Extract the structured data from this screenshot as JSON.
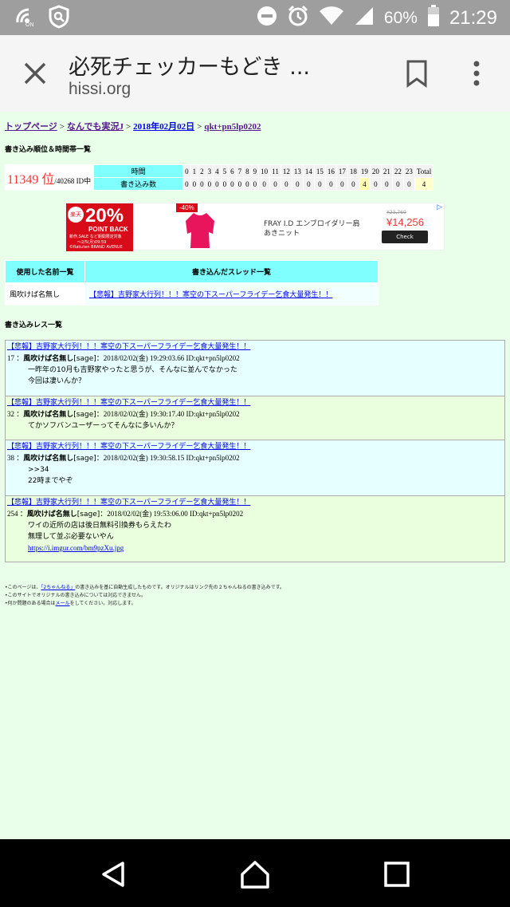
{
  "status_bar": {
    "nfc_label": "ON",
    "battery": "60%",
    "time": "21:29"
  },
  "toolbar": {
    "title": "必死チェッカーもどき ...",
    "url": "hissi.org"
  },
  "breadcrumb": [
    "トップページ",
    "なんでも実況J",
    "2018年02月02日",
    "qkt+pn5lp0202"
  ],
  "breadcrumb_sep": ">",
  "section_rank_title": "書き込み順位＆時間帯一覧",
  "rank": {
    "position": "11349 位",
    "total": "/40268 ID中",
    "row_time_label": "時間",
    "row_count_label": "書き込み数",
    "hours": [
      "0",
      "1",
      "2",
      "3",
      "4",
      "5",
      "6",
      "7",
      "8",
      "9",
      "10",
      "11",
      "12",
      "13",
      "14",
      "15",
      "16",
      "17",
      "18",
      "19",
      "20",
      "21",
      "22",
      "23",
      "Total"
    ],
    "counts": [
      "0",
      "0",
      "0",
      "0",
      "0",
      "0",
      "0",
      "0",
      "0",
      "0",
      "0",
      "0",
      "0",
      "0",
      "0",
      "0",
      "0",
      "0",
      "0",
      "4",
      "0",
      "0",
      "0",
      "0",
      "4"
    ]
  },
  "ad": {
    "badge": "楽天",
    "percent": "20%",
    "point_back": "POINT BACK",
    "line1": "新作,SALE など期間限定対象",
    "line2": "〜2/5(月)09:59",
    "line3": "©Rakuten BRAND AVENUE",
    "tag": "-40%",
    "desc_line1": "FRAY I.D エンブロイダリー肩",
    "desc_line2": "あきニット",
    "old_price": "¥23,760",
    "price": "¥14,256",
    "button": "Check",
    "accent": "#d80c18"
  },
  "names_table": {
    "header_names": "使用した名前一覧",
    "header_threads": "書き込んだスレッド一覧",
    "name": "風吹けば名無し",
    "thread": "【悲報】吉野家大行列！！！寒空の下スーパーフライデー乞食大量発生！！"
  },
  "section_posts_title": "書き込みレス一覧",
  "posts": [
    {
      "thread": "【悲報】吉野家大行列！！！寒空の下スーパーフライデー乞食大量発生！！",
      "num": "17",
      "name": "風吹けば名無し",
      "mail": "[sage]",
      "meta": "：2018/02/02(金) 19:29:03.66 ID:qkt+pn5lp0202",
      "lines": [
        "一昨年の10月も吉野家やったと思うが、そんなに並んでなかった",
        "今回は凄いんか？"
      ],
      "link": ""
    },
    {
      "thread": "【悲報】吉野家大行列！！！寒空の下スーパーフライデー乞食大量発生！！",
      "num": "32",
      "name": "風吹けば名無し",
      "mail": "[sage]",
      "meta": "：2018/02/02(金) 19:30:17.40 ID:qkt+pn5lp0202",
      "lines": [
        "てかソフバンユーザーってそんなに多いんか？"
      ],
      "link": ""
    },
    {
      "thread": "【悲報】吉野家大行列！！！寒空の下スーパーフライデー乞食大量発生！！",
      "num": "38",
      "name": "風吹けば名無し",
      "mail": "[sage]",
      "meta": "：2018/02/02(金) 19:30:58.15 ID:qkt+pn5lp0202",
      "lines": [
        ">>34",
        "22時までやぞ"
      ],
      "link": ""
    },
    {
      "thread": "【悲報】吉野家大行列！！！寒空の下スーパーフライデー乞食大量発生！！",
      "num": "254",
      "name": "風吹けば名無し",
      "mail": "[sage]",
      "meta": "：2018/02/02(金) 19:53:06.00 ID:qkt+pn5lp0202",
      "lines": [
        "ワイの近所の店は後日無料引換券もらえたわ",
        "無理して並ぶ必要ないやん"
      ],
      "link": "https://i.imgur.com/bm9pzXu.jpg"
    }
  ],
  "footer": {
    "l1_pre": "•このページは、",
    "l1_link": "「2ちゃんねる」",
    "l1_post": "の書き込みを基に自動生成したものです。オリジナルはリンク先の２ちゃんねるの書き込みです。",
    "l2": "•このサイトでオリジナルの書き込みについては対応できません。",
    "l3_pre": "•何か問題のある場合は",
    "l3_link": "メール",
    "l3_post": "をしてください。対応します。"
  }
}
